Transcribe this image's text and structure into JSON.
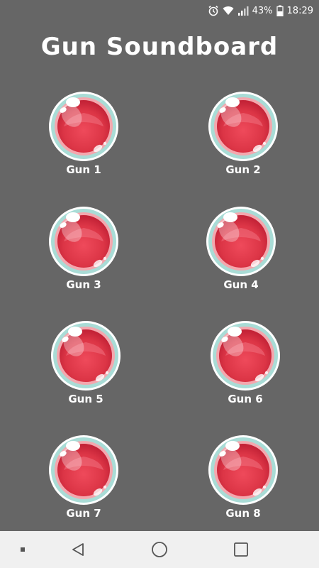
{
  "status_bar": {
    "battery_percent": "43%",
    "time": "18:29"
  },
  "header": {
    "title": "Gun Soundboard"
  },
  "buttons": [
    {
      "label": "Gun 1"
    },
    {
      "label": "Gun 2"
    },
    {
      "label": "Gun 3"
    },
    {
      "label": "Gun 4"
    },
    {
      "label": "Gun 5"
    },
    {
      "label": "Gun 6"
    },
    {
      "label": "Gun 7"
    },
    {
      "label": "Gun 8"
    }
  ],
  "colors": {
    "background": "#666666",
    "orb_red": "#e03a4c",
    "orb_ring": "#a9dcd6",
    "navbar": "#f0f0f0"
  },
  "icons": {
    "status": [
      "alarm-icon",
      "wifi-icon",
      "signal-icon",
      "battery-icon"
    ],
    "navigation": [
      "recents-dot-icon",
      "back-icon",
      "home-icon",
      "overview-icon"
    ]
  }
}
